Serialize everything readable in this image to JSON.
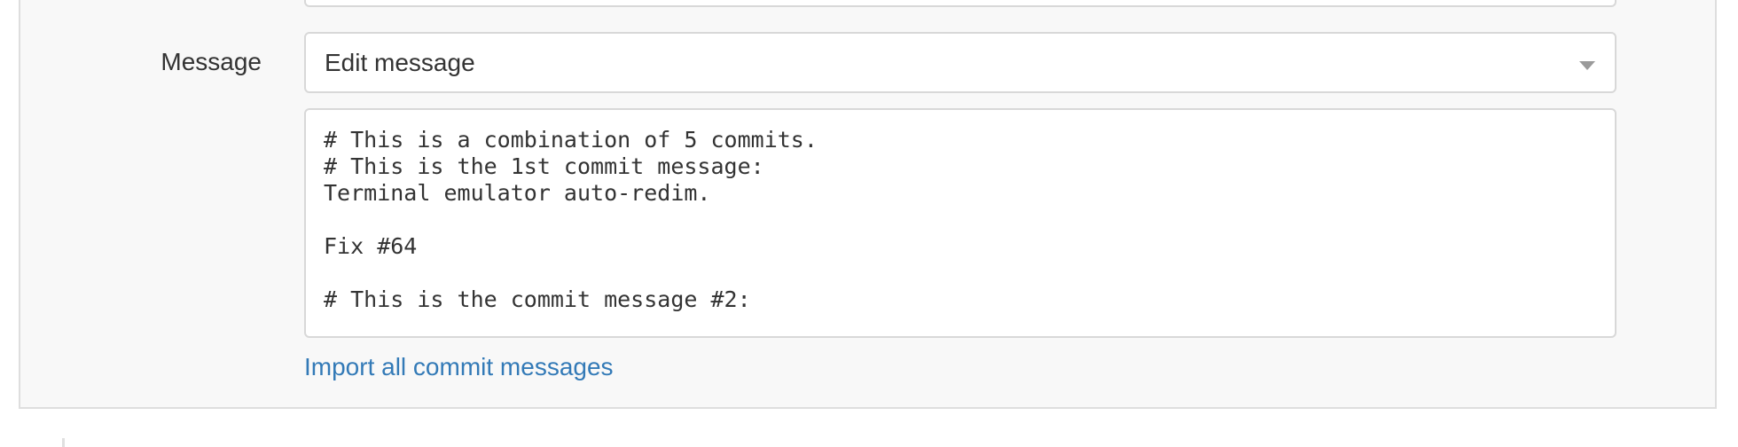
{
  "form": {
    "message_label": "Message",
    "message_mode": {
      "selected": "Edit message"
    },
    "commit_message": "# This is a combination of 5 commits.\n# This is the 1st commit message:\nTerminal emulator auto-redim.\n\nFix #64\n\n# This is the commit message #2:",
    "import_link_label": "Import all commit messages",
    "icons": {
      "select_caret": "chevron-down-icon"
    }
  },
  "colors": {
    "panel_background": "#f8f8f8",
    "border": "#d8d8d8",
    "text": "#333333",
    "link": "#337ab7",
    "caret": "#9a9a9a"
  }
}
